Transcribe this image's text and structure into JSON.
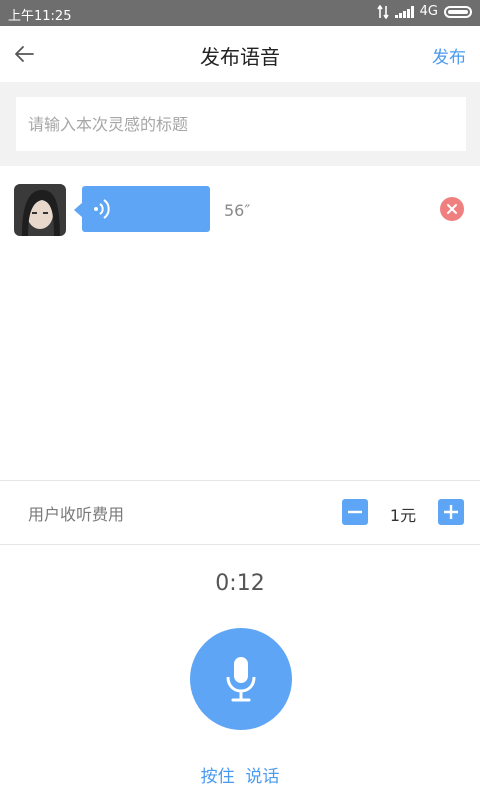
{
  "status_bar": {
    "time": "上午11:25",
    "network": "4G"
  },
  "header": {
    "title": "发布语音",
    "publish_label": "发布"
  },
  "title_input": {
    "placeholder": "请输入本次灵感的标题",
    "value": ""
  },
  "voice_message": {
    "duration": "56″"
  },
  "fee": {
    "label": "用户收听费用",
    "value": "1元"
  },
  "recorder": {
    "timer": "0:12",
    "hold_label": "按住  说话"
  },
  "colors": {
    "accent": "#4a9bf0",
    "bubble": "#5ea6f5",
    "delete": "#f08080",
    "status_bar": "#6e6e6e"
  }
}
